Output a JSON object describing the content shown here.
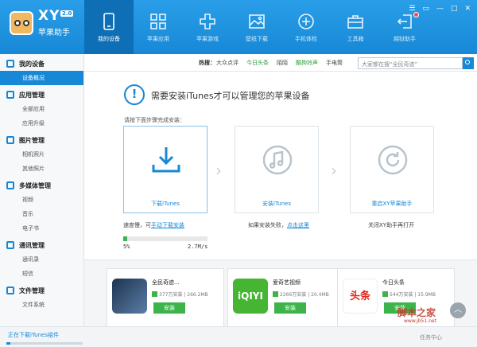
{
  "brand": {
    "short": "XY",
    "version": "2.0",
    "name": "苹果助手"
  },
  "nav": [
    {
      "label": "我的设备",
      "icon": "phone-icon",
      "active": true
    },
    {
      "label": "苹果应用",
      "icon": "apps-grid-icon"
    },
    {
      "label": "苹果游戏",
      "icon": "gamepad-cross-icon"
    },
    {
      "label": "壁纸下载",
      "icon": "wallpaper-image-icon"
    },
    {
      "label": "手机体检",
      "icon": "checkup-plus-icon"
    },
    {
      "label": "工具箱",
      "icon": "toolbox-icon"
    },
    {
      "label": "越狱助手",
      "icon": "jailbreak-exit-icon",
      "badge": true
    }
  ],
  "sidebar": [
    {
      "title": "我的设备",
      "icon": "device-icon",
      "items": [
        "设备概况"
      ]
    },
    {
      "title": "应用管理",
      "icon": "apps-icon",
      "items": [
        "全部应用",
        "应用升级"
      ]
    },
    {
      "title": "图片管理",
      "icon": "picture-icon",
      "items": [
        "相机照片",
        "其他照片"
      ]
    },
    {
      "title": "多媒体管理",
      "icon": "media-icon",
      "items": [
        "视频",
        "音乐",
        "电子书"
      ]
    },
    {
      "title": "通讯管理",
      "icon": "contacts-icon",
      "items": [
        "通讯录",
        "短信"
      ]
    },
    {
      "title": "文件管理",
      "icon": "folder-icon",
      "items": [
        "文件系统"
      ]
    }
  ],
  "hot": {
    "label": "热搜：",
    "links": [
      "大众点评",
      "今日头条",
      "陌陌",
      "酷狗铃声",
      "手电筒"
    ]
  },
  "search": {
    "placeholder": "大家都在搜“全民奇迹”"
  },
  "notice": {
    "title": "需要安装iTunes才可以管理您的苹果设备",
    "sub": "请按下面步骤完成安装："
  },
  "steps": [
    {
      "label": "下载iTunes",
      "icon": "download-icon"
    },
    {
      "label": "安装iTunes",
      "icon": "music-note-icon"
    },
    {
      "label": "重启XY苹果助手",
      "icon": "restart-icon"
    }
  ],
  "notes": {
    "slow": "速度慢，可",
    "slow_link": "手动下载安装",
    "fail": "如果安装失败，",
    "fail_link": "点击这里",
    "restart": "关闭XY助手再打开"
  },
  "progress": {
    "percent": "5%",
    "speed": "2.7M/s",
    "fraction": 0.05
  },
  "apps": [
    {
      "name": "全民奇迹...",
      "installs": "377万安装",
      "size": "266.2MB",
      "button": "安装"
    },
    {
      "name": "爱奇艺视频",
      "installs": "2266万安装",
      "size": "20.4MB",
      "button": "安装",
      "icon_text": "iQIYI"
    },
    {
      "name": "今日头条",
      "installs": "544万安装",
      "size": "15.9MB",
      "button": "安装",
      "icon_text": "头条"
    }
  ],
  "status": {
    "text": "正在下载iTunes组件",
    "task": "任务中心"
  },
  "watermark": {
    "main": "脚本之家",
    "url": "www.jb51.net"
  },
  "colors": {
    "primary": "#1788d6",
    "green": "#3cb44a"
  }
}
